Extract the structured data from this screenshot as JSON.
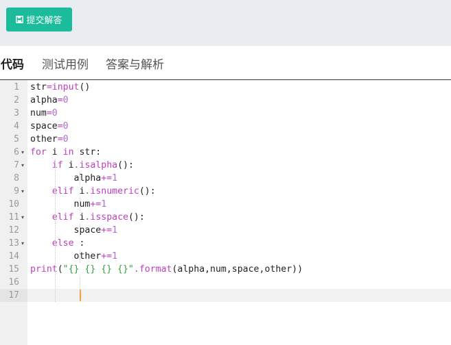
{
  "toolbar": {
    "submit_label": "提交解答",
    "accent": "#1abc9c"
  },
  "tabs": [
    {
      "label": "代码",
      "active": true
    },
    {
      "label": "测试用例",
      "active": false
    },
    {
      "label": "答案与解析",
      "active": false
    }
  ],
  "editor": {
    "line_numbers": [
      "1",
      "2",
      "3",
      "4",
      "5",
      "6",
      "7",
      "8",
      "9",
      "10",
      "11",
      "12",
      "13",
      "14",
      "15",
      "16",
      "17"
    ],
    "active_line": "17",
    "lines": [
      "str=input()",
      "alpha=0",
      "num=0",
      "space=0",
      "other=0",
      "for i in str:",
      "    if i.isalpha():",
      "        alpha+=1",
      "    elif i.isnumeric():",
      "        num+=1",
      "    elif i.isspace():",
      "        space+=1",
      "    else :",
      "        other+=1",
      "print(\"{} {} {} {}\".format(alpha,num,space,other))",
      "",
      ""
    ],
    "foldable_lines": [
      "6",
      "7",
      "9",
      "11",
      "13"
    ]
  }
}
